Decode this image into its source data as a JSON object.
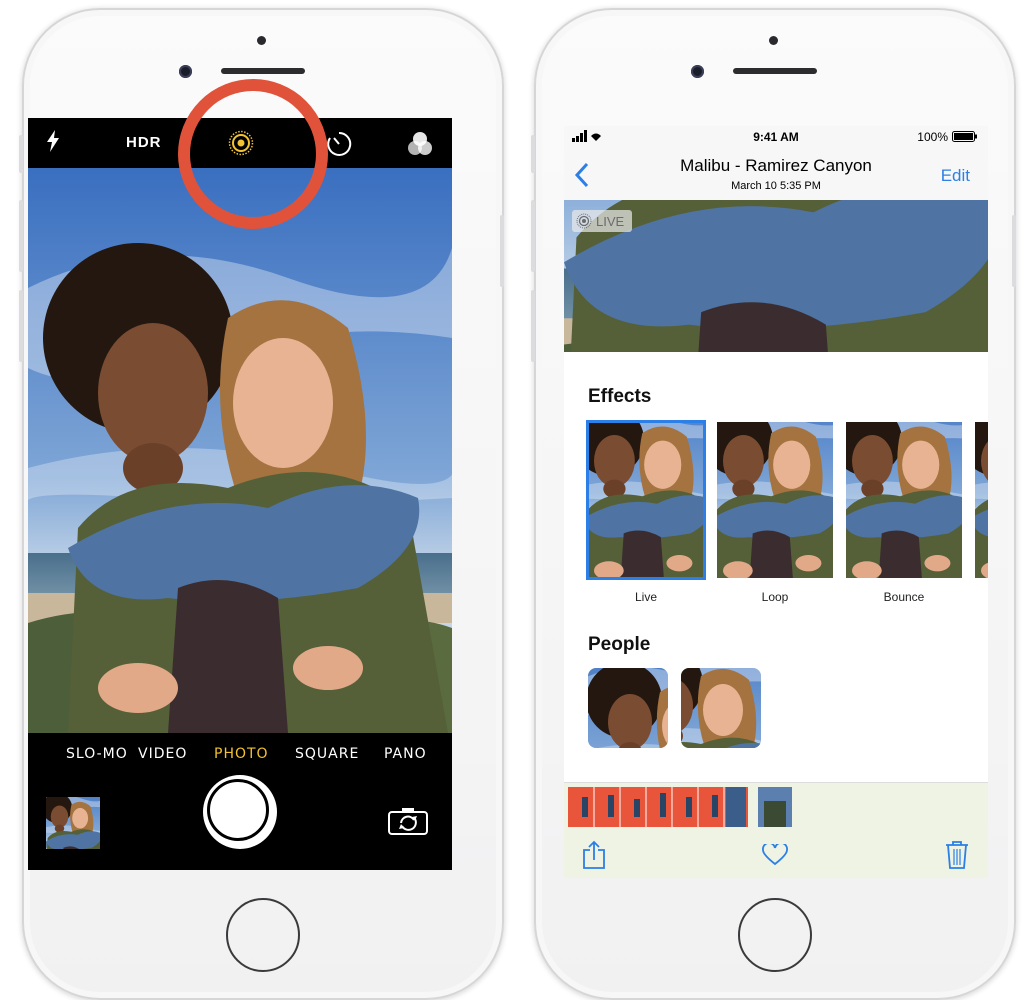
{
  "camera": {
    "hdr_label": "HDR",
    "modes": [
      "SLO-MO",
      "VIDEO",
      "PHOTO",
      "SQUARE",
      "PANO"
    ],
    "active_mode": "PHOTO",
    "icons": [
      "flash-icon",
      "live-photo-icon",
      "timer-icon",
      "filters-icon",
      "shutter-button",
      "switch-camera-icon"
    ],
    "highlight_color": "#e0533a",
    "accent_color": "#f1c232"
  },
  "photos": {
    "status": {
      "time": "9:41 AM",
      "battery": "100%"
    },
    "nav": {
      "title": "Malibu - Ramirez Canyon",
      "subtitle": "March 10  5:35 PM",
      "edit": "Edit"
    },
    "live_badge": "LIVE",
    "effects_heading": "Effects",
    "effects": [
      {
        "label": "Live",
        "selected": true
      },
      {
        "label": "Loop",
        "selected": false
      },
      {
        "label": "Bounce",
        "selected": false
      }
    ],
    "people_heading": "People",
    "accent_color": "#2b7fe6",
    "toolbar_icons": [
      "share-icon",
      "heart-icon",
      "trash-icon"
    ]
  }
}
